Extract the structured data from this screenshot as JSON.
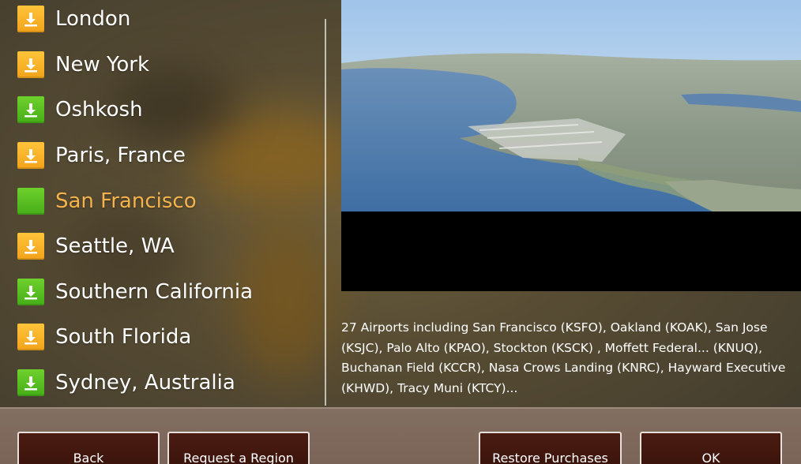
{
  "regions": [
    {
      "label": "London",
      "icon": "download-icon",
      "status": "available"
    },
    {
      "label": "New York",
      "icon": "download-icon",
      "status": "available"
    },
    {
      "label": "Oshkosh",
      "icon": "download-icon",
      "status": "installed"
    },
    {
      "label": "Paris, France",
      "icon": "download-icon",
      "status": "available"
    },
    {
      "label": "San Francisco",
      "icon": "installed-square-icon",
      "status": "selected"
    },
    {
      "label": "Seattle, WA",
      "icon": "download-icon",
      "status": "available"
    },
    {
      "label": "Southern California",
      "icon": "download-icon",
      "status": "installed"
    },
    {
      "label": "South Florida",
      "icon": "download-icon",
      "status": "available"
    },
    {
      "label": "Sydney, Australia",
      "icon": "download-icon",
      "status": "installed"
    }
  ],
  "colors": {
    "available_icon": "#f5a623",
    "installed_icon": "#5cbf23",
    "selected_label": "#f6b34b",
    "button_bg": "#3f160d",
    "bottom_bar_bg": "#7e685b"
  },
  "preview": {
    "description": "27 Airports including San Francisco (KSFO), Oakland (KOAK), San Jose (KSJC), Palo Alto (KPAO), Stockton (KSCK) , Moffett Federal... (KNUQ), Buchanan Field (KCCR), Nasa Crows Landing (KNRC), Hayward Executive (KHWD), Tracy Muni (KTCY)..."
  },
  "buttons": {
    "back": "Back",
    "request_region": "Request a Region",
    "restore_purchases": "Restore Purchases",
    "ok": "OK"
  }
}
